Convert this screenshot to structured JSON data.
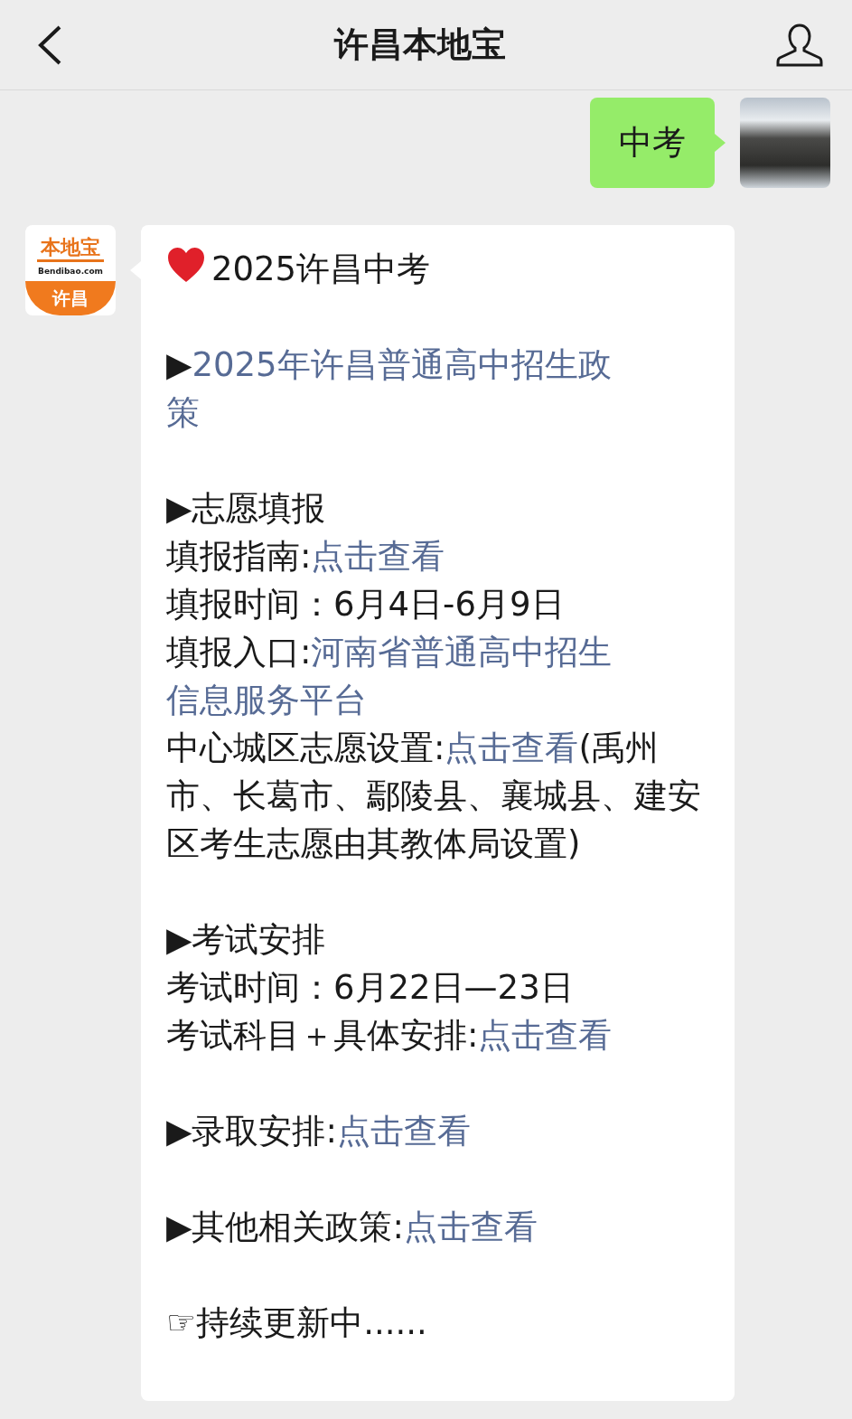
{
  "header": {
    "title": "许昌本地宝"
  },
  "messages": [
    {
      "kind": "outgoing",
      "text": "中考"
    },
    {
      "kind": "incoming",
      "logo": {
        "brand": "本地宝",
        "domain": "Bendibao.com",
        "city": "许昌"
      },
      "blocks": [
        [
          {
            "kind": "heart",
            "segments": [
              {
                "kind": "text",
                "text": "2025许昌中考"
              }
            ]
          }
        ],
        [
          {
            "segments": [
              {
                "kind": "text",
                "text": "▶"
              },
              {
                "kind": "link",
                "text": "2025年许昌普通高中招生政"
              }
            ]
          },
          {
            "segments": [
              {
                "kind": "link",
                "text": "策"
              }
            ]
          }
        ],
        [
          {
            "segments": [
              {
                "kind": "text",
                "text": "▶志愿填报"
              }
            ]
          },
          {
            "segments": [
              {
                "kind": "text",
                "text": "填报指南:"
              },
              {
                "kind": "link",
                "text": "点击查看"
              }
            ]
          },
          {
            "segments": [
              {
                "kind": "text",
                "text": "填报时间：6月4日-6月9日"
              }
            ]
          },
          {
            "segments": [
              {
                "kind": "text",
                "text": "填报入口:"
              },
              {
                "kind": "link",
                "text": "河南省普通高中招生"
              }
            ]
          },
          {
            "segments": [
              {
                "kind": "link",
                "text": "信息服务平台"
              }
            ]
          },
          {
            "segments": [
              {
                "kind": "text",
                "text": "中心城区志愿设置:"
              },
              {
                "kind": "link",
                "text": "点击查看"
              },
              {
                "kind": "text",
                "text": "(禹州市、长葛市、鄢陵县、襄城县、建安区考生志愿由其教体局设置)"
              }
            ]
          }
        ],
        [
          {
            "segments": [
              {
                "kind": "text",
                "text": "▶考试安排"
              }
            ]
          },
          {
            "segments": [
              {
                "kind": "text",
                "text": "考试时间：6月22日—23日"
              }
            ]
          },
          {
            "segments": [
              {
                "kind": "text",
                "text": "考试科目＋具体安排:"
              },
              {
                "kind": "link",
                "text": "点击查看"
              }
            ]
          }
        ],
        [
          {
            "segments": [
              {
                "kind": "text",
                "text": "▶录取安排:"
              },
              {
                "kind": "link",
                "text": "点击查看"
              }
            ]
          }
        ],
        [
          {
            "segments": [
              {
                "kind": "text",
                "text": "▶其他相关政策:"
              },
              {
                "kind": "link",
                "text": "点击查看"
              }
            ]
          }
        ],
        [
          {
            "segments": [
              {
                "kind": "text",
                "text": "☞持续更新中......"
              }
            ]
          }
        ]
      ]
    }
  ]
}
